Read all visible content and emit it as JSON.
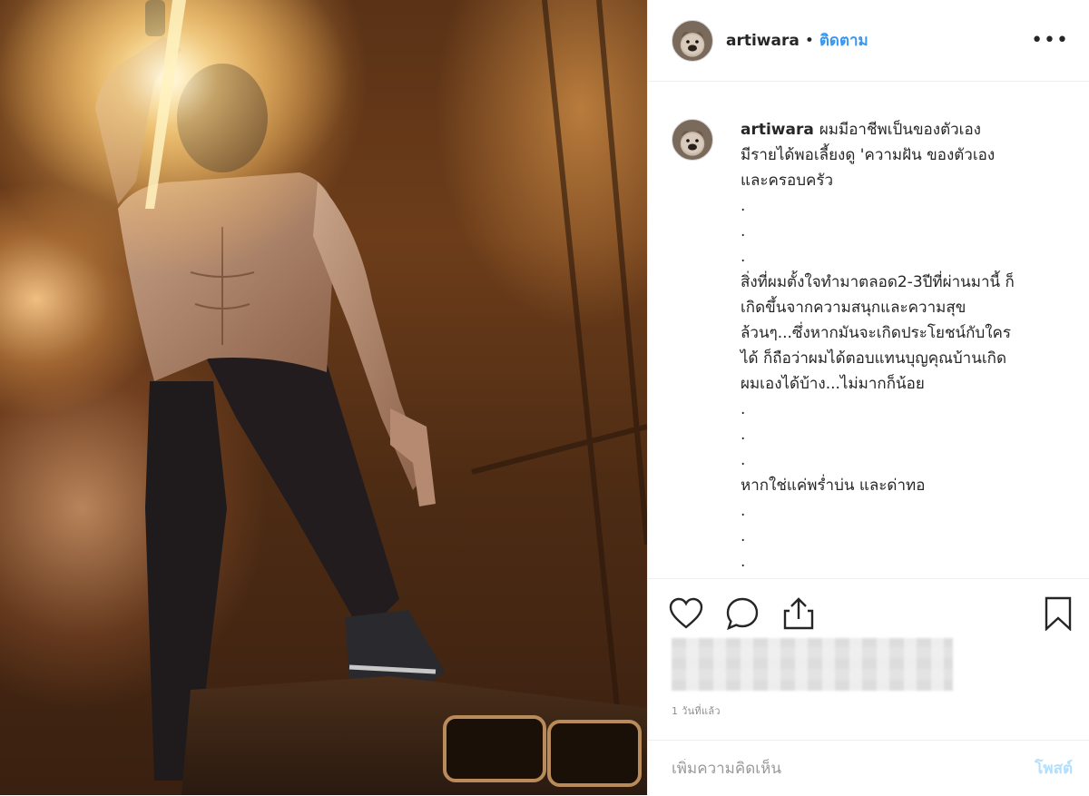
{
  "colors": {
    "accent": "#3897f0",
    "text": "#262626",
    "muted": "#8e8e8e",
    "post_button_disabled": "#b2dffc",
    "divider": "#efefef"
  },
  "photo": {
    "subject": "shirtless performer on stage holding a microphone, one foot on a stage monitor, with bright stage light and smoke"
  },
  "header": {
    "username": "artiwara",
    "separator": "•",
    "follow_label": "ติดตาม",
    "more_icon": "ellipsis-icon",
    "more_label": "•••"
  },
  "caption": {
    "username": "artiwara",
    "text": "ผมมีอาชีพเป็นของตัวเอง\nมีรายได้พอเลี้ยงดู 'ความฝัน ของตัวเอง\nและครอบครัว\n.\n.\n.\nสิ่งที่ผมตั้งใจทำมาตลอด2-3ปีที่ผ่านมานี้ ก็\nเกิดขึ้นจากความสนุกและความสุข\nล้วนๆ...ซึ่งหากมันจะเกิดประโยชน์กับใคร\nได้ ก็ถือว่าผมได้ตอบแทนบุญคุณบ้านเกิด\nผมเองได้บ้าง...ไม่มากก็น้อย\n.\n.\n.\nหากใช่แค่พร่ำบ่น และด่าทอ\n.\n.\n.\nพอเถอะครับ หากเลอมาของทุกคนคือการ"
  },
  "actions": {
    "like_icon": "heart-icon",
    "comment_icon": "comment-icon",
    "share_icon": "share-icon",
    "save_icon": "bookmark-icon"
  },
  "timestamp": "1 วันที่แล้ว",
  "comment": {
    "placeholder": "เพิ่มความคิดเห็น",
    "post_label": "โพสต์"
  }
}
